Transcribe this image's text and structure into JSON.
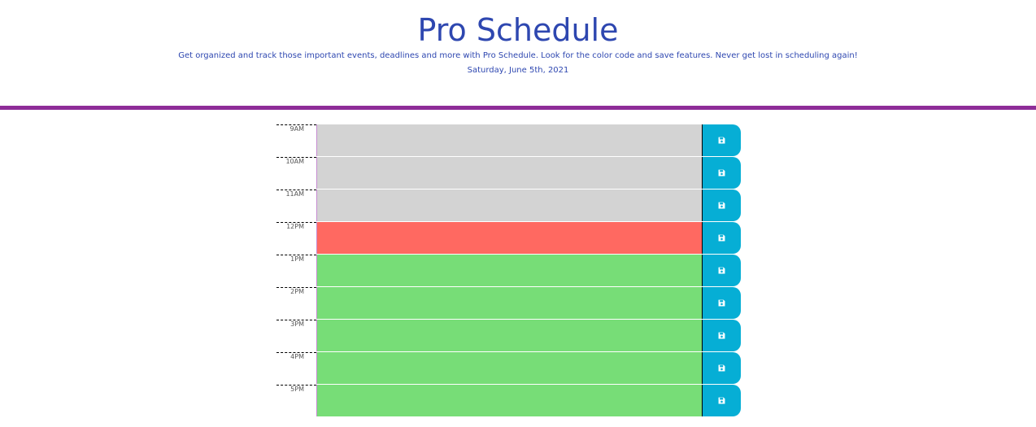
{
  "header": {
    "title": "Pro Schedule",
    "lead": "Get organized and track those important events, deadlines and more with Pro Schedule. Look for the color code and save features. Never get lost in scheduling again!",
    "current_date": "Saturday, June 5th, 2021"
  },
  "colors": {
    "title": "#2e47b0",
    "divider": "#8e2c98",
    "past": "#d3d3d3",
    "present": "#ff6961",
    "future": "#77dd77",
    "save_button": "#06aed5"
  },
  "save_icon": "floppy-disk-icon",
  "time_blocks": [
    {
      "hour": "9AM",
      "status": "past",
      "text": ""
    },
    {
      "hour": "10AM",
      "status": "past",
      "text": ""
    },
    {
      "hour": "11AM",
      "status": "past",
      "text": ""
    },
    {
      "hour": "12PM",
      "status": "present",
      "text": ""
    },
    {
      "hour": "1PM",
      "status": "future",
      "text": ""
    },
    {
      "hour": "2PM",
      "status": "future",
      "text": ""
    },
    {
      "hour": "3PM",
      "status": "future",
      "text": ""
    },
    {
      "hour": "4PM",
      "status": "future",
      "text": ""
    },
    {
      "hour": "5PM",
      "status": "future",
      "text": ""
    }
  ]
}
